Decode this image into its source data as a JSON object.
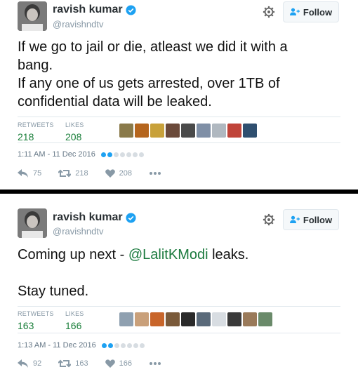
{
  "tweets": [
    {
      "author": {
        "name": "ravish kumar",
        "handle": "@ravishndtv"
      },
      "follow_label": "Follow",
      "text_lines": [
        "If we go to jail or die, atleast we did it with a",
        "bang.",
        "If any one of us gets arrested, over 1TB of",
        "confidential data will be leaked."
      ],
      "stats": {
        "retweets_label": "RETWEETS",
        "retweets": "218",
        "likes_label": "LIKES",
        "likes": "208"
      },
      "timestamp": "1:11 AM - 11 Dec 2016",
      "actions": {
        "reply": "75",
        "retweet": "218",
        "like": "208"
      }
    },
    {
      "author": {
        "name": "ravish kumar",
        "handle": "@ravishndtv"
      },
      "follow_label": "Follow",
      "text": {
        "prefix": "Coming up next - ",
        "mention": "@LalitKModi",
        "suffix": " leaks.",
        "line2": "Stay tuned."
      },
      "stats": {
        "retweets_label": "RETWEETS",
        "retweets": "163",
        "likes_label": "LIKES",
        "likes": "166"
      },
      "timestamp": "1:13 AM - 11 Dec 2016",
      "actions": {
        "reply": "92",
        "retweet": "163",
        "like": "166"
      }
    }
  ],
  "icons": {
    "verified": "verified-badge-icon",
    "settings": "gear-icon",
    "follow": "add-person-icon",
    "reply": "reply-icon",
    "retweet": "retweet-icon",
    "like": "heart-icon",
    "more": "more-dots-icon"
  },
  "colors": {
    "accent_blue": "#1da1f2",
    "stat_green": "#1a7f3a",
    "mention_green": "#1b7a3e",
    "muted": "#8899a6"
  }
}
